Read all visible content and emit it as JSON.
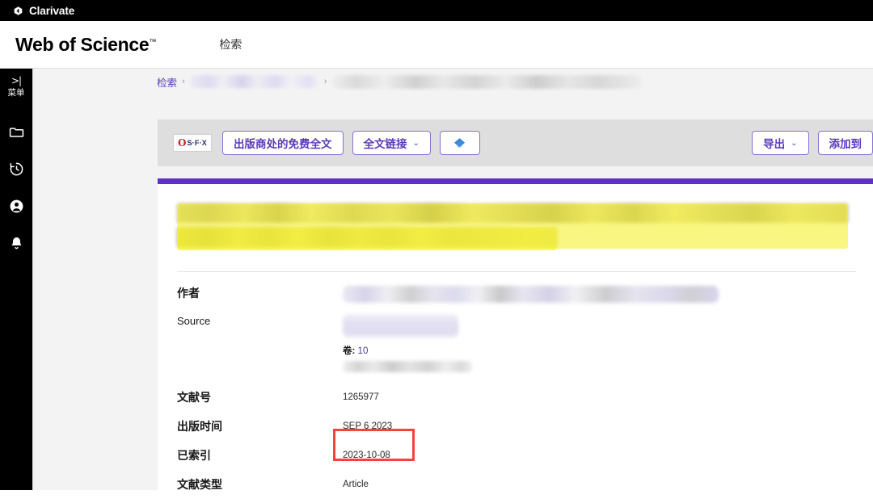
{
  "brand": {
    "company": "Clarivate",
    "company_logo_icon": "clarivate-chevron-icon",
    "product": "Web of Science",
    "product_tm": "™"
  },
  "header": {
    "nav_items": [
      {
        "label": "检索",
        "name": "nav-search"
      }
    ]
  },
  "sidebar": {
    "menu": {
      "glyph": ">|",
      "label": "菜单",
      "icon": "expand-menu-icon"
    },
    "items": [
      {
        "name": "sidebar-item-folder",
        "icon": "folder-icon"
      },
      {
        "name": "sidebar-item-history",
        "icon": "history-clock-icon"
      },
      {
        "name": "sidebar-item-profile",
        "icon": "user-account-icon"
      },
      {
        "name": "sidebar-item-notifications",
        "icon": "bell-icon"
      }
    ]
  },
  "breadcrumb": {
    "root_label": "检索",
    "separator": "›",
    "redacted_items": 2
  },
  "toolbar": {
    "sfx": {
      "mark": "O",
      "text": "S·F·X",
      "icon": "sfx-logo-icon"
    },
    "buttons": [
      {
        "name": "free-full-text-button",
        "label": "出版商处的免费全文",
        "chevron": ""
      },
      {
        "name": "full-text-links-button",
        "label": "全文链接",
        "chevron": "⌄"
      }
    ],
    "gem_button": {
      "name": "open-access-gem-button",
      "icon": "blue-diamond-icon"
    },
    "export_button": {
      "label": "导出",
      "chevron": "⌄"
    },
    "add_to_button": {
      "label": "添加到"
    }
  },
  "record": {
    "accent_color": "#5f30c4",
    "highlight_color": "#f6f033",
    "title_redacted": true,
    "fields": [
      {
        "name": "field-authors",
        "label": "作者",
        "label_weight": "bold",
        "value_type": "redacted"
      },
      {
        "name": "field-source",
        "label": "Source",
        "label_weight": "regular",
        "value_type": "redacted"
      },
      {
        "name": "field-article-number",
        "label": "文献号",
        "label_weight": "bold",
        "value": "1265977"
      },
      {
        "name": "field-published",
        "label": "出版时间",
        "label_weight": "bold",
        "value": "SEP 6 2023"
      },
      {
        "name": "field-indexed",
        "label": "已索引",
        "label_weight": "bold",
        "value": "2023-10-08"
      },
      {
        "name": "field-doc-type",
        "label": "文献类型",
        "label_weight": "bold",
        "value": "Article"
      }
    ],
    "volume": {
      "label": "卷",
      "separator": ":",
      "value": "10"
    }
  },
  "annotation": {
    "type": "red-rectangle-highlight",
    "target_field": "已索引",
    "target_value": "2023-10-08",
    "color": "#f4443c"
  }
}
